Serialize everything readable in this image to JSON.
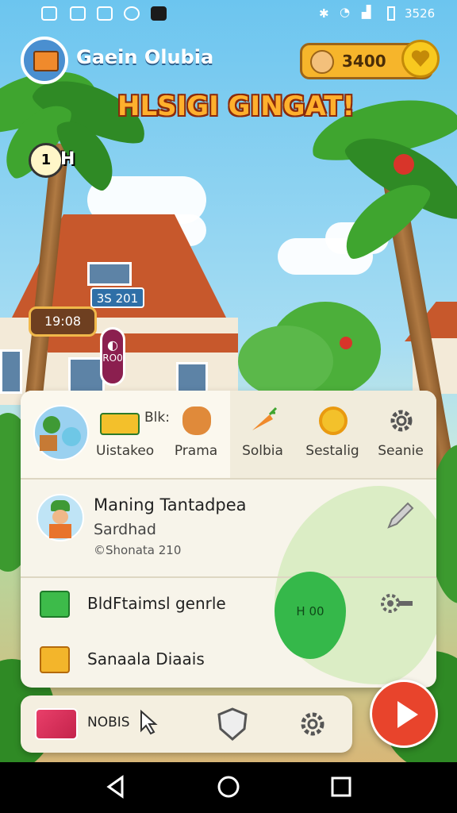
{
  "status_bar": {
    "time": "3526"
  },
  "header": {
    "game_title": "Gaein Olubia",
    "coins": "3400",
    "banner": "HLSIGI GINGAT!"
  },
  "scene": {
    "bubble_text": "H",
    "sign_text": "3S 201",
    "timer_text": "19:08",
    "pin_text": "RO0"
  },
  "tabs": {
    "extra_label": "Blk:",
    "items": [
      {
        "label": "Uistakeo",
        "icon": "character-group-icon"
      },
      {
        "label": "Prama",
        "icon": "bear-icon"
      },
      {
        "label": "Solbia",
        "icon": "carrot-icon"
      },
      {
        "label": "Sestalig",
        "icon": "sun-icon"
      },
      {
        "label": "Seanie",
        "icon": "gear-icon"
      }
    ]
  },
  "profile": {
    "name": "Maning Tantadpea",
    "subtitle": "Sardhad",
    "copyright": "©Shonata 210"
  },
  "leaf_badge": "H 00",
  "list": [
    {
      "label": "BldFtaimsl genrle",
      "icon": "green-box-icon"
    },
    {
      "label": "Sanaala Diaais",
      "icon": "orange-box-icon"
    }
  ],
  "dock": {
    "label": "NOBIS"
  },
  "colors": {
    "accent": "#e8442c",
    "coin": "#f6b52b",
    "leaf": "#35b84a"
  }
}
